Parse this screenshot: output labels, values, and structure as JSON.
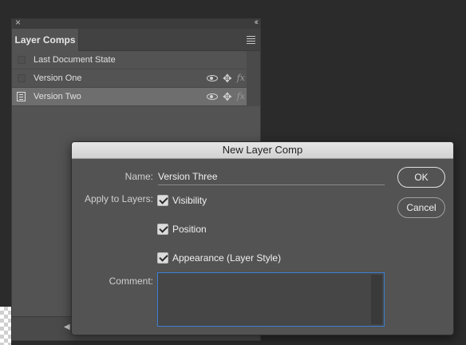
{
  "panel": {
    "tab_title": "Layer Comps",
    "comps": [
      {
        "name": "Last Document State",
        "selected": false,
        "icon": "checkbox",
        "show_options": false
      },
      {
        "name": "Version One",
        "selected": false,
        "icon": "checkbox",
        "show_options": true
      },
      {
        "name": "Version Two",
        "selected": true,
        "icon": "layer-comp-icon",
        "show_options": true
      }
    ],
    "fx_label": "fx"
  },
  "dialog": {
    "title": "New Layer Comp",
    "name_label": "Name:",
    "name_value": "Version Three",
    "apply_label": "Apply to Layers:",
    "options": [
      {
        "label": "Visibility",
        "checked": true
      },
      {
        "label": "Position",
        "checked": true
      },
      {
        "label": "Appearance (Layer Style)",
        "checked": true
      }
    ],
    "comment_label": "Comment:",
    "comment_value": "",
    "ok_label": "OK",
    "cancel_label": "Cancel"
  },
  "colors": {
    "panel_bg": "#535353",
    "selected_row": "#6e6e6e",
    "focus_border": "#3b7fd4",
    "dialog_titlebar": "#dcdcdc"
  }
}
